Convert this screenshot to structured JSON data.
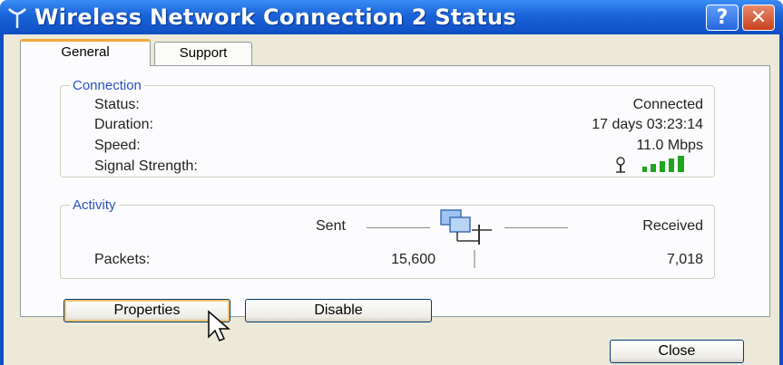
{
  "window": {
    "title": "Wireless Network Connection 2 Status",
    "help_label": "?",
    "close_label": "✕"
  },
  "tabs": [
    {
      "label": "General",
      "active": true
    },
    {
      "label": "Support",
      "active": false
    }
  ],
  "connection": {
    "group_label": "Connection",
    "rows": [
      {
        "label": "Status:",
        "value": "Connected"
      },
      {
        "label": "Duration:",
        "value": "17 days 03:23:14"
      },
      {
        "label": "Speed:",
        "value": "11.0 Mbps"
      },
      {
        "label": "Signal Strength:",
        "value": ""
      }
    ],
    "signal_bars_lit": 5,
    "signal_bars_total": 5
  },
  "activity": {
    "group_label": "Activity",
    "sent_label": "Sent",
    "received_label": "Received",
    "packets_label": "Packets:",
    "packets_sent": "15,600",
    "packets_received": "7,018"
  },
  "buttons": {
    "properties": "Properties",
    "disable": "Disable",
    "close": "Close"
  },
  "colors": {
    "titlebar": "#1a63d8",
    "group_label": "#2a52be",
    "signal": "#1fa51f",
    "tab_highlight": "#f1a93a"
  },
  "icons": {
    "title": "wireless-antenna-icon",
    "activity": "network-computers-icon",
    "cursor": "mouse-pointer-icon"
  }
}
